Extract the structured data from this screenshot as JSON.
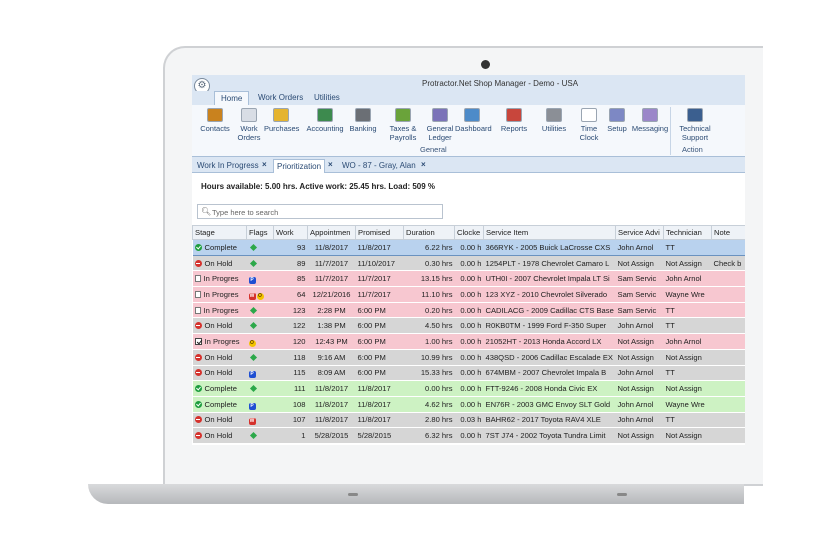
{
  "window": {
    "title": "Protractor.Net Shop Manager - Demo - USA"
  },
  "ribbon_tabs": [
    "Home",
    "Work Orders",
    "Utilities"
  ],
  "ribbon": {
    "buttons": [
      {
        "label": "Contacts",
        "icon": "contacts-icon",
        "color": "#c9821e"
      },
      {
        "label": "Work\nOrders",
        "icon": "work-orders-icon",
        "color": "#d8dde5"
      },
      {
        "label": "Purchases",
        "icon": "purchases-icon",
        "color": "#e5b42f"
      },
      {
        "label": "Accounting",
        "icon": "accounting-icon",
        "color": "#3d8a4e"
      },
      {
        "label": "Banking",
        "icon": "banking-icon",
        "color": "#6b6f75"
      },
      {
        "label": "Taxes &\nPayrolls",
        "icon": "taxes-payrolls-icon",
        "color": "#6aa33a"
      },
      {
        "label": "General\nLedger",
        "icon": "general-ledger-icon",
        "color": "#7b73b8"
      },
      {
        "label": "Dashboard",
        "icon": "dashboard-icon",
        "color": "#4d8bc9"
      },
      {
        "label": "Reports",
        "icon": "reports-icon",
        "color": "#c8463c"
      },
      {
        "label": "Utilities",
        "icon": "utilities-icon",
        "color": "#8b8f96"
      },
      {
        "label": "Time\nClock",
        "icon": "time-clock-icon",
        "color": "#ffffff"
      },
      {
        "label": "Setup",
        "icon": "setup-icon",
        "color": "#7d88c4"
      },
      {
        "label": "Messaging",
        "icon": "messaging-icon",
        "color": "#9b87c9"
      },
      {
        "label": "Technical\nSupport",
        "icon": "technical-support-icon",
        "color": "#3b5f8f"
      }
    ],
    "groups": [
      "General",
      "Action"
    ]
  },
  "doc_tabs": [
    {
      "label": "Work In Progress"
    },
    {
      "label": "Prioritization"
    },
    {
      "label": "WO - 87 - Gray, Alan"
    }
  ],
  "hours_summary": "Hours available: 5.00 hrs. Active work: 25.45 hrs. Load: 509 %",
  "search": {
    "placeholder": "Type here to search"
  },
  "grid": {
    "columns": [
      "Stage",
      "Flags",
      "Work",
      "Appointmen",
      "Promised",
      "Duration",
      "Clocke",
      "Service Item",
      "Service Advi",
      "Technician",
      "Note"
    ],
    "rows": [
      {
        "stage": "Complete",
        "status": "ok",
        "flags": [
          "diamond"
        ],
        "work": "93",
        "appt": "11/8/2017",
        "promised": "11/8/2017",
        "duration": "6.22 hrs",
        "clocked": "0.00 h",
        "item": "366RYK - 2005 Buick LaCrosse CXS",
        "advisor": "John Arnol",
        "tech": "TT",
        "note": "",
        "bg": "#c9def5",
        "selected": true
      },
      {
        "stage": "On Hold",
        "status": "hold",
        "flags": [
          "diamond"
        ],
        "work": "89",
        "appt": "11/7/2017",
        "promised": "11/10/2017",
        "duration": "0.30 hrs",
        "clocked": "0.00 h",
        "item": "1254PLT - 1978 Chevrolet Camaro L",
        "advisor": "Not Assign",
        "tech": "Not Assign",
        "note": "Check b",
        "bg": "#d6d6d6"
      },
      {
        "stage": "In Progres",
        "status": "prog",
        "flags": [
          "blue:P"
        ],
        "work": "85",
        "appt": "11/7/2017",
        "promised": "11/7/2017",
        "duration": "13.15 hrs",
        "clocked": "0.00 h",
        "item": "UTH0I - 2007 Chevrolet Impala LT Si",
        "advisor": "Sam Servic",
        "tech": "John Arnol",
        "note": "",
        "bg": "#f7c7d0"
      },
      {
        "stage": "In Progres",
        "status": "prog",
        "flags": [
          "red:W",
          "yellow:O"
        ],
        "work": "64",
        "appt": "12/21/2016",
        "promised": "11/7/2017",
        "duration": "11.10 hrs",
        "clocked": "0.00 h",
        "item": "123 XYZ - 2010 Chevrolet Silverado",
        "advisor": "Sam Servic",
        "tech": "Wayne Wre",
        "note": "",
        "bg": "#f7c7d0"
      },
      {
        "stage": "In Progres",
        "status": "prog",
        "flags": [
          "diamond"
        ],
        "work": "123",
        "appt": "2:28 PM",
        "promised": "6:00 PM",
        "duration": "0.20 hrs",
        "clocked": "0.00 h",
        "item": "CADILACG - 2009 Cadillac CTS Base",
        "advisor": "Sam Servic",
        "tech": "TT",
        "note": "",
        "bg": "#f7c7d0"
      },
      {
        "stage": "On Hold",
        "status": "hold",
        "flags": [
          "diamond"
        ],
        "work": "122",
        "appt": "1:38 PM",
        "promised": "6:00 PM",
        "duration": "4.50 hrs",
        "clocked": "0.00 h",
        "item": "R0KB0TM - 1999 Ford F-350 Super",
        "advisor": "John Arnol",
        "tech": "TT",
        "note": "",
        "bg": "#d6d6d6"
      },
      {
        "stage": "In Progres",
        "status": "check",
        "flags": [
          "yellow:O"
        ],
        "work": "120",
        "appt": "12:43 PM",
        "promised": "6:00 PM",
        "duration": "1.00 hrs",
        "clocked": "0.00 h",
        "item": "21052HT - 2013 Honda Accord LX",
        "advisor": "Not Assign",
        "tech": "John Arnol",
        "note": "",
        "bg": "#f7c7d0"
      },
      {
        "stage": "On Hold",
        "status": "hold",
        "flags": [
          "diamond"
        ],
        "work": "118",
        "appt": "9:16 AM",
        "promised": "6:00 PM",
        "duration": "10.99 hrs",
        "clocked": "0.00 h",
        "item": "438QSD - 2006 Cadillac Escalade EX",
        "advisor": "Not Assign",
        "tech": "Not Assign",
        "note": "",
        "bg": "#d6d6d6"
      },
      {
        "stage": "On Hold",
        "status": "hold",
        "flags": [
          "blue:P"
        ],
        "work": "115",
        "appt": "8:09 AM",
        "promised": "6:00 PM",
        "duration": "15.33 hrs",
        "clocked": "0.00 h",
        "item": "674MBM - 2007 Chevrolet Impala B",
        "advisor": "John Arnol",
        "tech": "TT",
        "note": "",
        "bg": "#d6d6d6"
      },
      {
        "stage": "Complete",
        "status": "ok",
        "flags": [
          "diamond"
        ],
        "work": "111",
        "appt": "11/8/2017",
        "promised": "11/8/2017",
        "duration": "0.00 hrs",
        "clocked": "0.00 h",
        "item": "FTT-9246 - 2008 Honda Civic EX",
        "advisor": "Not Assign",
        "tech": "Not Assign",
        "note": "",
        "bg": "#cdf2c3"
      },
      {
        "stage": "Complete",
        "status": "ok",
        "flags": [
          "blue:P"
        ],
        "work": "108",
        "appt": "11/8/2017",
        "promised": "11/8/2017",
        "duration": "4.62 hrs",
        "clocked": "0.00 h",
        "item": "EN76R - 2003 GMC Envoy SLT Gold",
        "advisor": "John Arnol",
        "tech": "Wayne Wre",
        "note": "",
        "bg": "#cdf2c3"
      },
      {
        "stage": "On Hold",
        "status": "hold",
        "flags": [
          "red:W"
        ],
        "work": "107",
        "appt": "11/8/2017",
        "promised": "11/8/2017",
        "duration": "2.80 hrs",
        "clocked": "0.03 h",
        "item": "BAHR62 - 2017 Toyota RAV4 XLE",
        "advisor": "John Arnol",
        "tech": "TT",
        "note": "",
        "bg": "#d6d6d6"
      },
      {
        "stage": "On Hold",
        "status": "hold",
        "flags": [
          "diamond"
        ],
        "work": "1",
        "appt": "5/28/2015",
        "promised": "5/28/2015",
        "duration": "6.32 hrs",
        "clocked": "0.00 h",
        "item": "7ST J74 - 2002 Toyota Tundra Limit",
        "advisor": "Not Assign",
        "tech": "Not Assign",
        "note": "",
        "bg": "#d6d6d6"
      }
    ]
  },
  "colors": {
    "accent": "#2b4b74",
    "ribbon_bg": "#dbe6f3"
  }
}
